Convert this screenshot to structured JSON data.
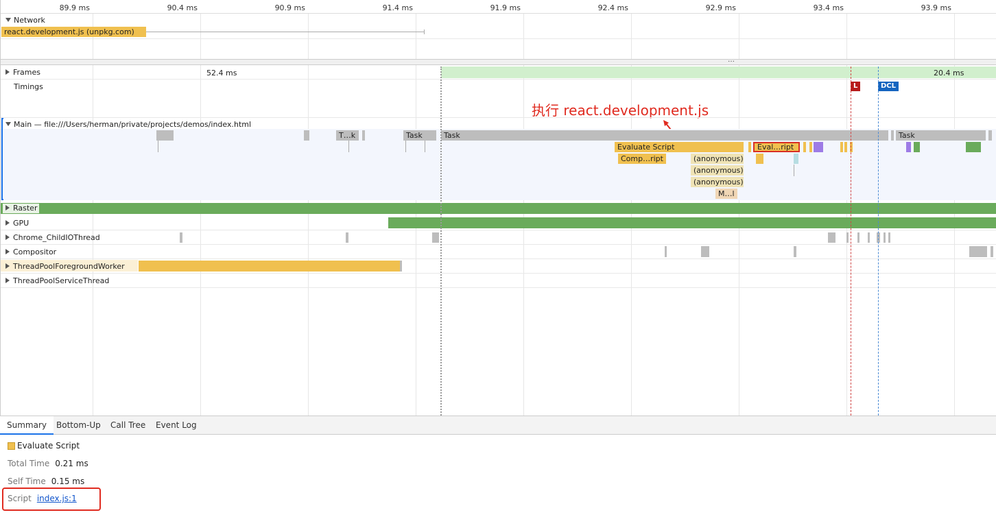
{
  "ruler": {
    "ticks": [
      "89.9 ms",
      "90.4 ms",
      "90.9 ms",
      "91.4 ms",
      "91.9 ms",
      "92.4 ms",
      "92.9 ms",
      "93.4 ms",
      "93.9 ms"
    ]
  },
  "network": {
    "label": "Network",
    "request": "react.development.js (unpkg.com)"
  },
  "frames": {
    "label": "Frames",
    "frame1": "52.4 ms",
    "frame2": "20.4 ms"
  },
  "timings": {
    "label": "Timings",
    "l_marker": "L",
    "dcl_marker": "DCL"
  },
  "annotation": {
    "text": "执行 react.development.js",
    "color": "#e02b20"
  },
  "main": {
    "label": "Main — file:///Users/herman/private/projects/demos/index.html",
    "tasks": [
      "T…k",
      "Task",
      "Task",
      "Task"
    ],
    "evaluate_script": "Evaluate Script",
    "eval_highlight": "Eval…ript",
    "compile_script": "Comp…ript",
    "anonymous": [
      "(anonymous)",
      "(anonymous)",
      "(anonymous)"
    ],
    "ml": "M…l"
  },
  "tracks": {
    "raster": "Raster",
    "gpu": "GPU",
    "childio": "Chrome_ChildIOThread",
    "compositor": "Compositor",
    "foreground": "ThreadPoolForegroundWorker",
    "service": "ThreadPoolServiceThread"
  },
  "bottom": {
    "tabs": [
      "Summary",
      "Bottom-Up",
      "Call Tree",
      "Event Log"
    ],
    "title": "Evaluate Script",
    "total_time_label": "Total Time",
    "total_time": "0.21 ms",
    "self_time_label": "Self Time",
    "self_time": "0.15 ms",
    "script_label": "Script",
    "script_link": "index.js:1"
  },
  "colors": {
    "scripting": "#f0c04f",
    "rendering": "#9d7be6",
    "painting": "#6aab5b",
    "l_marker": "#b71c1c",
    "dcl_marker": "#1565c0"
  }
}
